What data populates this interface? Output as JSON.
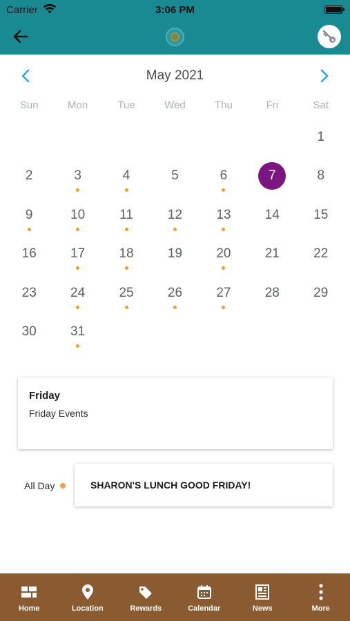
{
  "status_bar": {
    "carrier": "Carrier",
    "time": "3:06 PM"
  },
  "calendar": {
    "month_title": "May 2021",
    "weekdays": [
      "Sun",
      "Mon",
      "Tue",
      "Wed",
      "Thu",
      "Fri",
      "Sat"
    ],
    "weeks": [
      [
        {
          "d": ""
        },
        {
          "d": ""
        },
        {
          "d": ""
        },
        {
          "d": ""
        },
        {
          "d": ""
        },
        {
          "d": ""
        },
        {
          "d": "1"
        }
      ],
      [
        {
          "d": "2"
        },
        {
          "d": "3",
          "dot": true
        },
        {
          "d": "4",
          "dot": true
        },
        {
          "d": "5"
        },
        {
          "d": "6",
          "dot": true
        },
        {
          "d": "7",
          "selected": true
        },
        {
          "d": "8"
        }
      ],
      [
        {
          "d": "9",
          "dot": true
        },
        {
          "d": "10",
          "dot": true
        },
        {
          "d": "11",
          "dot": true
        },
        {
          "d": "12",
          "dot": true
        },
        {
          "d": "13",
          "dot": true
        },
        {
          "d": "14"
        },
        {
          "d": "15"
        }
      ],
      [
        {
          "d": "16"
        },
        {
          "d": "17",
          "dot": true
        },
        {
          "d": "18",
          "dot": true
        },
        {
          "d": "19"
        },
        {
          "d": "20",
          "dot": true
        },
        {
          "d": "21"
        },
        {
          "d": "22"
        }
      ],
      [
        {
          "d": "23"
        },
        {
          "d": "24",
          "dot": true
        },
        {
          "d": "25",
          "dot": true
        },
        {
          "d": "26",
          "dot": true
        },
        {
          "d": "27",
          "dot": true
        },
        {
          "d": "28"
        },
        {
          "d": "29"
        }
      ],
      [
        {
          "d": "30"
        },
        {
          "d": "31",
          "dot": true
        },
        {
          "d": ""
        },
        {
          "d": ""
        },
        {
          "d": ""
        },
        {
          "d": ""
        },
        {
          "d": ""
        }
      ]
    ]
  },
  "day_card": {
    "title": "Friday",
    "subtitle": "Friday Events"
  },
  "event": {
    "time": "All Day",
    "title": "SHARON'S LUNCH GOOD FRIDAY!"
  },
  "tabs": [
    {
      "label": "Home",
      "icon": "grid-icon"
    },
    {
      "label": "Location",
      "icon": "map-pin-icon"
    },
    {
      "label": "Rewards",
      "icon": "tag-icon"
    },
    {
      "label": "Calendar",
      "icon": "calendar-icon"
    },
    {
      "label": "News",
      "icon": "newspaper-icon"
    },
    {
      "label": "More",
      "icon": "more-vertical-icon"
    }
  ],
  "colors": {
    "header": "#1a8a92",
    "selected_day": "#7b1680",
    "event_dot": "#f0a020",
    "tab_bar": "#8a5a30",
    "nav_arrow": "#29a8e0"
  }
}
